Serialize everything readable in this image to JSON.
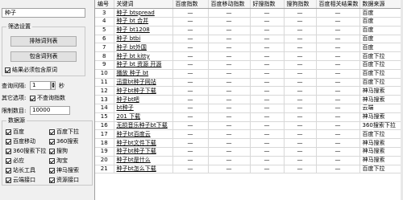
{
  "keyword": "种子",
  "filter": {
    "title": "筛选设置",
    "exclude_btn": "排除词列表",
    "include_btn": "包含词列表",
    "must_include": "结果必须包含原词"
  },
  "options": {
    "interval_label": "查询间隔:",
    "interval_value": "1",
    "interval_unit": "秒",
    "other_label": "其它选项:",
    "skip_index": "不查询指数",
    "limit_label": "限制数目:",
    "limit_value": "10000"
  },
  "sources": {
    "title": "数据源",
    "items": [
      {
        "label": "百度",
        "checked": true
      },
      {
        "label": "百度下拉",
        "checked": true
      },
      {
        "label": "百度移动",
        "checked": true
      },
      {
        "label": "360搜索",
        "checked": true
      },
      {
        "label": "360搜索下拉",
        "checked": true
      },
      {
        "label": "搜狗",
        "checked": true
      },
      {
        "label": "必应",
        "checked": true
      },
      {
        "label": "淘宝",
        "checked": true
      },
      {
        "label": "站长工具",
        "checked": true
      },
      {
        "label": "神马搜索",
        "checked": true
      },
      {
        "label": "云端接口",
        "checked": true
      },
      {
        "label": "资源接口",
        "checked": true
      }
    ]
  },
  "table": {
    "columns": [
      "编号",
      "关键词",
      "百度指数",
      "百度移动指数",
      "好搜指数",
      "搜狗指数",
      "百度相关结果数",
      "数据来源"
    ],
    "rows": [
      [
        "3",
        "种子 btspread",
        "—",
        "—",
        "—",
        "—",
        "—",
        "百度"
      ],
      [
        "4",
        "种子 bt 合并",
        "—",
        "—",
        "—",
        "—",
        "—",
        "百度"
      ],
      [
        "5",
        "种子 bt1208",
        "—",
        "—",
        "—",
        "—",
        "—",
        "百度"
      ],
      [
        "6",
        "种子 btbi",
        "—",
        "—",
        "—",
        "—",
        "—",
        "百度"
      ],
      [
        "7",
        "种子 bt外国",
        "—",
        "—",
        "—",
        "—",
        "—",
        "百度"
      ],
      [
        "8",
        "种子 bt kitty",
        "—",
        "—",
        "—",
        "—",
        "—",
        "百度下拉"
      ],
      [
        "9",
        "种子 bt 资源 开源",
        "—",
        "—",
        "—",
        "—",
        "—",
        "百度下拉"
      ],
      [
        "10",
        "播放 种子 bt",
        "—",
        "—",
        "—",
        "—",
        "—",
        "百度下拉"
      ],
      [
        "11",
        "迅雷bt种子网站",
        "—",
        "—",
        "—",
        "—",
        "—",
        "百度下拉"
      ],
      [
        "12",
        "种子bt种子下载",
        "—",
        "—",
        "—",
        "—",
        "—",
        "神马搜索"
      ],
      [
        "13",
        "种子bt吧",
        "—",
        "—",
        "—",
        "—",
        "—",
        "神马搜索"
      ],
      [
        "14",
        "bt种子",
        "—",
        "—",
        "—",
        "—",
        "—",
        "云端"
      ],
      [
        "15",
        "201 下载",
        "—",
        "—",
        "—",
        "—",
        "—",
        "神马搜索"
      ],
      [
        "16",
        "无损音乐种子bt下载",
        "—",
        "—",
        "—",
        "—",
        "—",
        "360搜索下拉"
      ],
      [
        "17",
        "种子bt百度云",
        "—",
        "—",
        "—",
        "—",
        "—",
        "百度下拉"
      ],
      [
        "18",
        "种子bt文件下载",
        "—",
        "—",
        "—",
        "—",
        "—",
        "神马搜索"
      ],
      [
        "19",
        "种子bt种子下载",
        "—",
        "—",
        "—",
        "—",
        "—",
        "神马搜索"
      ],
      [
        "20",
        "种子bt是什么",
        "—",
        "—",
        "—",
        "—",
        "—",
        "神马搜索"
      ],
      [
        "21",
        "种子bt怎么下载",
        "—",
        "—",
        "—",
        "—",
        "—",
        "百度下拉"
      ]
    ]
  }
}
